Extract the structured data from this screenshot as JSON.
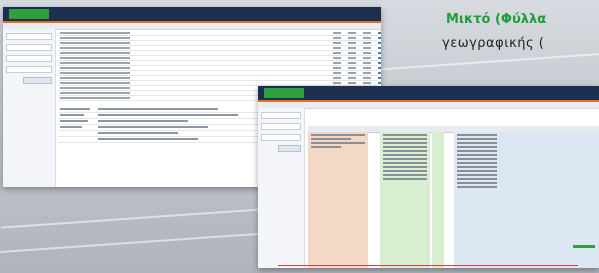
{
  "headline": "Μικτό (Φύλλα",
  "subline": "γεωγραφικής (",
  "colors": {
    "headline": "#1f9d3a",
    "topbar": "#1c2f4f",
    "accent": "#e0701e",
    "logo": "#2e9e3e"
  },
  "screenshot_1": {
    "logo_label": ""
  },
  "screenshot_2": {
    "logo_label": ""
  }
}
